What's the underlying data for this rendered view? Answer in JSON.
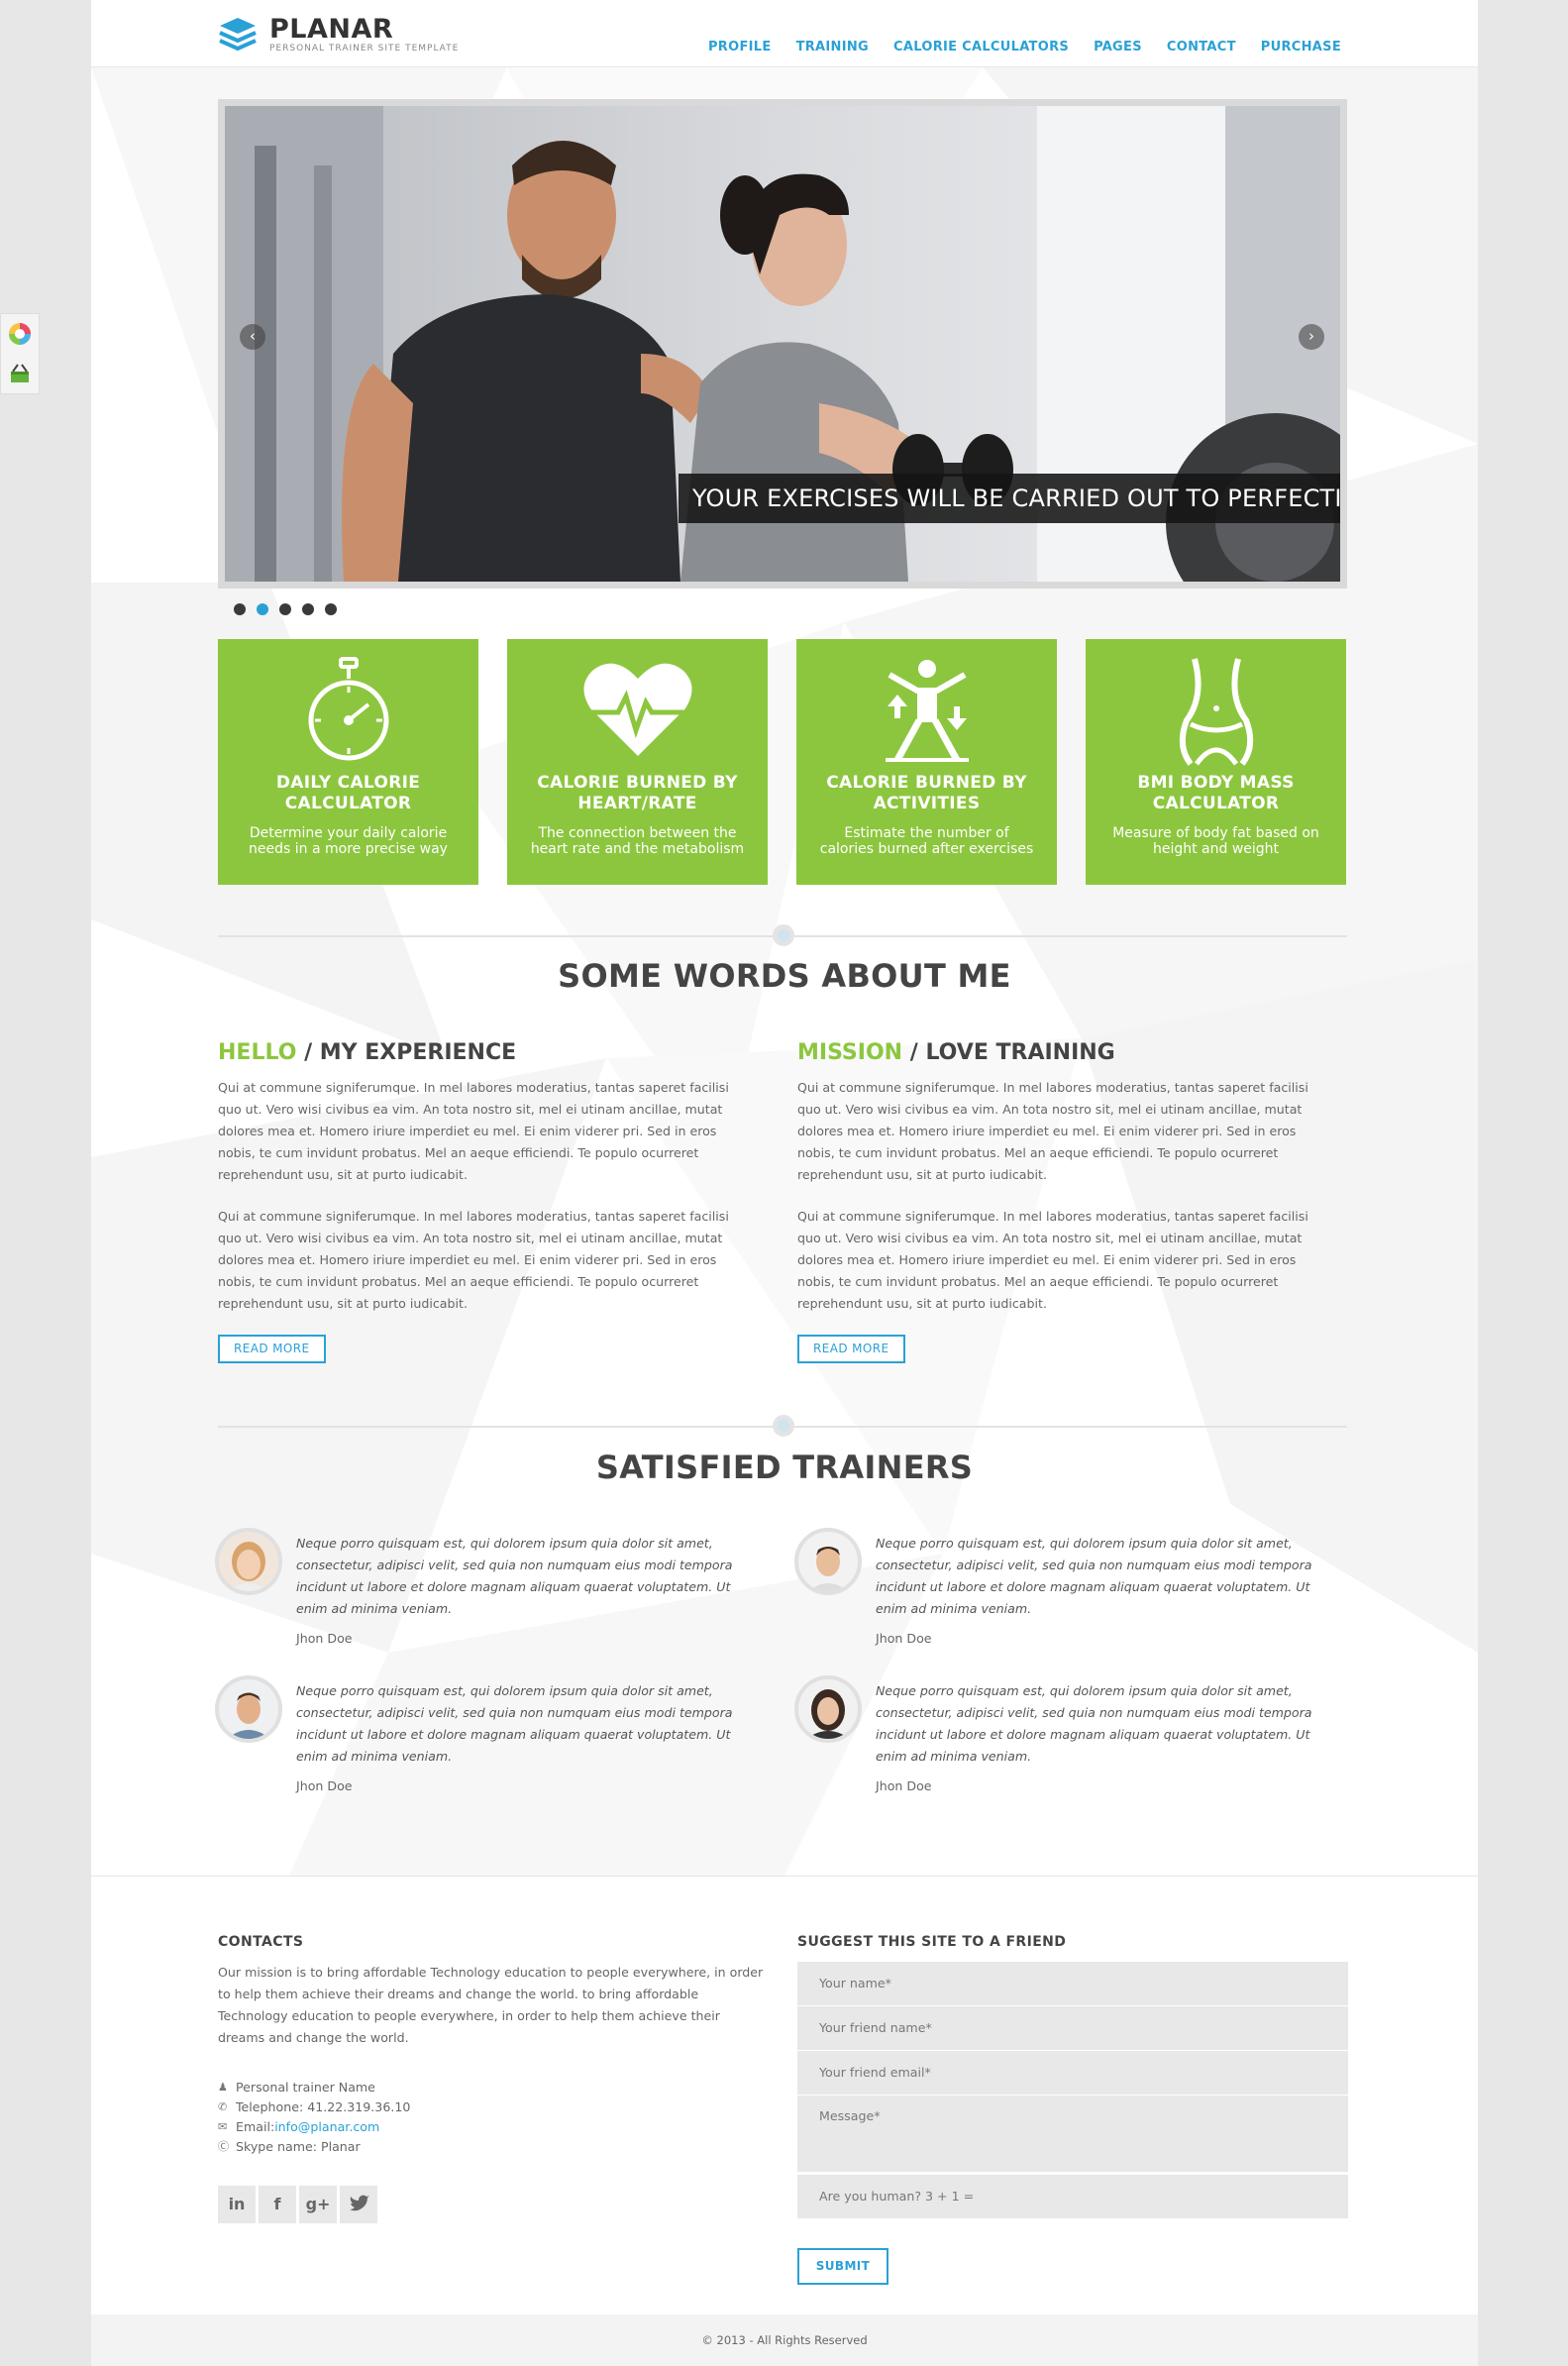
{
  "brand": {
    "name": "PLANAR",
    "tagline": "PERSONAL TRAINER SITE TEMPLATE",
    "accent": "#2aa1d6",
    "green": "#8cc63e"
  },
  "nav": [
    "PROFILE",
    "TRAINING",
    "CALORIE CALCULATORS",
    "PAGES",
    "CONTACT",
    "PURCHASE"
  ],
  "slider": {
    "caption": "YOUR EXERCISES WILL BE CARRIED OUT TO PERFECTION",
    "prev": "‹",
    "next": "›",
    "active_dot": 2,
    "dot_count": 5
  },
  "features": [
    {
      "icon": "stopwatch-icon",
      "title": "DAILY CALORIE CALCULATOR",
      "desc": "Determine your daily calorie needs in a more precise way"
    },
    {
      "icon": "heartbeat-icon",
      "title": "CALORIE BURNED BY HEART/RATE",
      "desc": "The connection between the heart rate and the metabolism"
    },
    {
      "icon": "exercise-figure-icon",
      "title": "CALORIE BURNED BY ACTIVITIES",
      "desc": "Estimate the number of calories burned after exercises"
    },
    {
      "icon": "body-waist-icon",
      "title": "BMI BODY MASS CALCULATOR",
      "desc": "Measure of body fat based on height and weight"
    }
  ],
  "about": {
    "title": "SOME WORDS ABOUT ME",
    "columns": [
      {
        "accent": "HELLO",
        "rest": " / MY EXPERIENCE",
        "p1": "Qui at commune signiferumque. In mel labores moderatius, tantas saperet facilisi quo ut. Vero wisi civibus ea vim. An tota nostro sit, mel ei utinam ancillae, mutat dolores mea et. Homero iriure imperdiet eu mel. Ei enim viderer pri. Sed in eros nobis, te cum invidunt probatus. Mel an aeque efficiendi. Te populo ocurreret reprehendunt usu, sit at purto iudicabit.",
        "p2": "Qui at commune signiferumque. In mel labores moderatius, tantas saperet facilisi quo ut. Vero wisi civibus ea vim. An tota nostro sit, mel ei utinam ancillae, mutat dolores mea et. Homero iriure imperdiet eu mel. Ei enim viderer pri. Sed in eros nobis, te cum invidunt probatus. Mel an aeque efficiendi. Te populo ocurreret reprehendunt usu, sit at purto iudicabit.",
        "button": "READ MORE"
      },
      {
        "accent": "MISSION",
        "rest": " / LOVE TRAINING",
        "p1": "Qui at commune signiferumque. In mel labores moderatius, tantas saperet facilisi quo ut. Vero wisi civibus ea vim. An tota nostro sit, mel ei utinam ancillae, mutat dolores mea et. Homero iriure imperdiet eu mel. Ei enim viderer pri. Sed in eros nobis, te cum invidunt probatus. Mel an aeque efficiendi. Te populo ocurreret reprehendunt usu, sit at purto iudicabit.",
        "p2": "Qui at commune signiferumque. In mel labores moderatius, tantas saperet facilisi quo ut. Vero wisi civibus ea vim. An tota nostro sit, mel ei utinam ancillae, mutat dolores mea et. Homero iriure imperdiet eu mel. Ei enim viderer pri. Sed in eros nobis, te cum invidunt probatus. Mel an aeque efficiendi. Te populo ocurreret reprehendunt usu, sit at purto iudicabit.",
        "button": "READ MORE"
      }
    ]
  },
  "testimonials": {
    "title": "SATISFIED TRAINERS",
    "items": [
      {
        "quote": "Neque porro quisquam est, qui dolorem ipsum quia dolor sit amet, consectetur, adipisci velit, sed quia non numquam eius modi tempora incidunt ut labore et dolore magnam aliquam quaerat voluptatem. Ut enim ad minima veniam.",
        "author": "Jhon Doe",
        "avatar": "female-blonde-avatar"
      },
      {
        "quote": "Neque porro quisquam est, qui dolorem ipsum quia dolor sit amet, consectetur, adipisci velit, sed quia non numquam eius modi tempora incidunt ut labore et dolore magnam aliquam quaerat voluptatem. Ut enim ad minima veniam.",
        "author": "Jhon Doe",
        "avatar": "male-smiling-avatar"
      },
      {
        "quote": "Neque porro quisquam est, qui dolorem ipsum quia dolor sit amet, consectetur, adipisci velit, sed quia non numquam eius modi tempora incidunt ut labore et dolore magnam aliquam quaerat voluptatem. Ut enim ad minima veniam.",
        "author": "Jhon Doe",
        "avatar": "male-avatar"
      },
      {
        "quote": "Neque porro quisquam est, qui dolorem ipsum quia dolor sit amet, consectetur, adipisci velit, sed quia non numquam eius modi tempora incidunt ut labore et dolore magnam aliquam quaerat voluptatem. Ut enim ad minima veniam.",
        "author": "Jhon Doe",
        "avatar": "female-brunette-avatar"
      }
    ]
  },
  "footer": {
    "contacts_title": "CONTACTS",
    "mission": "Our mission is to bring affordable Technology education to people everywhere, in order to help them achieve their dreams and change the world. to bring affordable Technology education to people everywhere, in order to help them achieve their dreams and change the world.",
    "name": "Personal trainer Name",
    "telephone": "Telephone: 41.22.319.36.10",
    "email_label": "Email: ",
    "email": "info@planar.com",
    "skype": "Skype name: Planar",
    "social": [
      "in",
      "f",
      "g+",
      "twitter"
    ],
    "form_title": "SUGGEST THIS SITE TO A FRIEND",
    "fields": {
      "your_name": "Your name*",
      "friend_name": "Your friend name*",
      "friend_email": "Your friend email*",
      "message": "Message*",
      "human": "Are you human? 3 + 1 ="
    },
    "submit": "SUBMIT",
    "copyright": "© 2013 - All Rights Reserved"
  }
}
